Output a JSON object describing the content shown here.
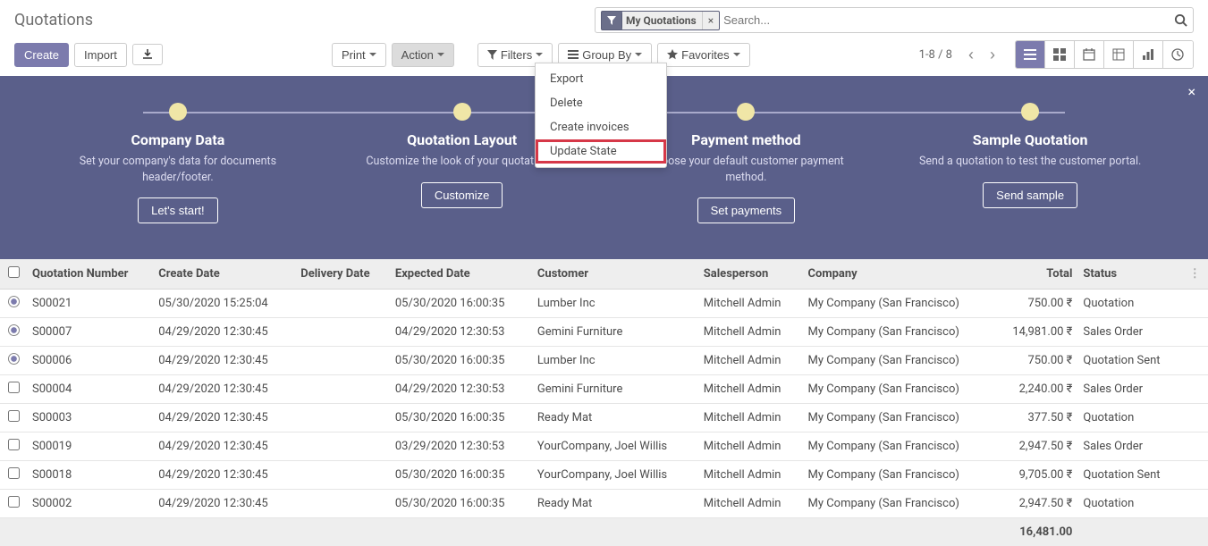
{
  "breadcrumb": "Quotations",
  "search": {
    "facet_label": "My Quotations",
    "placeholder": "Search..."
  },
  "buttons": {
    "create": "Create",
    "import": "Import",
    "print": "Print",
    "action": "Action",
    "filters": "Filters",
    "group_by": "Group By",
    "favorites": "Favorites"
  },
  "pager": "1-8 / 8",
  "dropdown": [
    "Export",
    "Delete",
    "Create invoices",
    "Update State"
  ],
  "onboard": [
    {
      "title": "Company Data",
      "desc": "Set your company's data for documents header/footer.",
      "btn": "Let's start!"
    },
    {
      "title": "Quotation Layout",
      "desc": "Customize the look of your quotations.",
      "btn": "Customize"
    },
    {
      "title": "Payment method",
      "desc": "Choose your default customer payment method.",
      "btn": "Set payments"
    },
    {
      "title": "Sample Quotation",
      "desc": "Send a quotation to test the customer portal.",
      "btn": "Send sample"
    }
  ],
  "cols": {
    "number": "Quotation Number",
    "create": "Create Date",
    "delivery": "Delivery Date",
    "expected": "Expected Date",
    "customer": "Customer",
    "sales": "Salesperson",
    "company": "Company",
    "total": "Total",
    "status": "Status"
  },
  "currency": "₹",
  "rows": [
    {
      "chk": true,
      "num": "S00021",
      "create": "05/30/2020 15:25:04",
      "expected": "05/30/2020 16:00:35",
      "customer": "Lumber Inc",
      "sales": "Mitchell Admin",
      "company": "My Company (San Francisco)",
      "total": "750.00",
      "status": "Quotation"
    },
    {
      "chk": true,
      "num": "S00007",
      "create": "04/29/2020 12:30:45",
      "expected": "04/29/2020 12:30:53",
      "customer": "Gemini Furniture",
      "sales": "Mitchell Admin",
      "company": "My Company (San Francisco)",
      "total": "14,981.00",
      "status": "Sales Order"
    },
    {
      "chk": true,
      "num": "S00006",
      "create": "04/29/2020 12:30:45",
      "expected": "05/30/2020 16:00:35",
      "customer": "Lumber Inc",
      "sales": "Mitchell Admin",
      "company": "My Company (San Francisco)",
      "total": "750.00",
      "status": "Quotation Sent"
    },
    {
      "chk": false,
      "num": "S00004",
      "create": "04/29/2020 12:30:45",
      "expected": "04/29/2020 12:30:53",
      "customer": "Gemini Furniture",
      "sales": "Mitchell Admin",
      "company": "My Company (San Francisco)",
      "total": "2,240.00",
      "status": "Sales Order"
    },
    {
      "chk": false,
      "num": "S00003",
      "create": "04/29/2020 12:30:45",
      "expected": "05/30/2020 16:00:35",
      "customer": "Ready Mat",
      "sales": "Mitchell Admin",
      "company": "My Company (San Francisco)",
      "total": "377.50",
      "status": "Quotation"
    },
    {
      "chk": false,
      "num": "S00019",
      "create": "04/29/2020 12:30:45",
      "expected": "03/29/2020 12:30:53",
      "customer": "YourCompany, Joel Willis",
      "sales": "Mitchell Admin",
      "company": "My Company (San Francisco)",
      "total": "2,947.50",
      "status": "Sales Order"
    },
    {
      "chk": false,
      "num": "S00018",
      "create": "04/29/2020 12:30:45",
      "expected": "05/30/2020 16:00:35",
      "customer": "YourCompany, Joel Willis",
      "sales": "Mitchell Admin",
      "company": "My Company (San Francisco)",
      "total": "9,705.00",
      "status": "Quotation Sent"
    },
    {
      "chk": false,
      "num": "S00002",
      "create": "04/29/2020 12:30:45",
      "expected": "05/30/2020 16:00:35",
      "customer": "Ready Mat",
      "sales": "Mitchell Admin",
      "company": "My Company (San Francisco)",
      "total": "2,947.50",
      "status": "Quotation"
    }
  ],
  "footer_total": "16,481.00"
}
